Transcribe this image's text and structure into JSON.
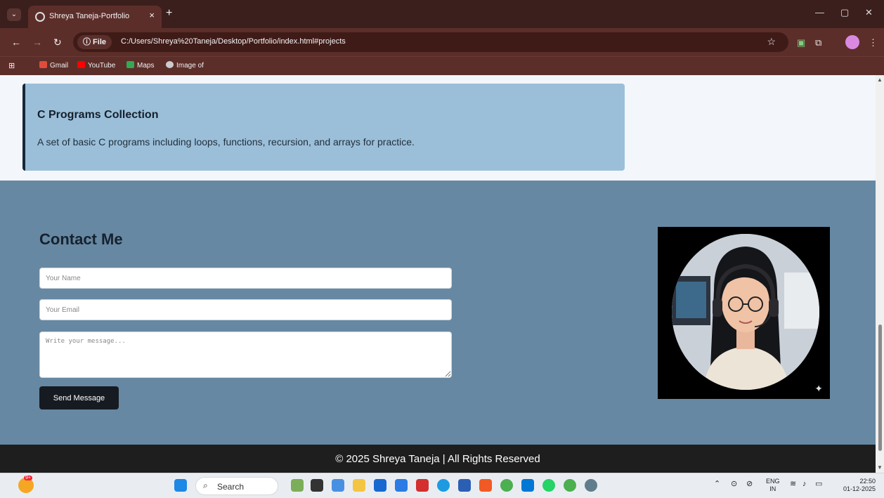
{
  "browser": {
    "tab_title": "Shreya Taneja-Portfolio",
    "tab_close": "×",
    "new_tab": "+",
    "address_chip": "ⓘ File",
    "url": "C:/Users/Shreya%20Taneja/Desktop/Portfolio/index.html#projects",
    "bookmarks": [
      "Gmail",
      "YouTube",
      "Maps",
      "Image of"
    ]
  },
  "project": {
    "title": "C Programs Collection",
    "description": "A set of basic C programs including loops, functions, recursion, and arrays for practice."
  },
  "contact": {
    "heading": "Contact Me",
    "name_placeholder": "Your Name",
    "email_placeholder": "Your Email",
    "message_placeholder": "Write your message...",
    "send_label": "Send Message"
  },
  "footer": {
    "text": "© 2025 Shreya Taneja | All Rights Reserved"
  },
  "taskbar": {
    "search_label": "Search",
    "notification_count": "9+",
    "language": "ENG",
    "region": "IN",
    "time": "22:50",
    "date": "01-12-2025"
  },
  "colors": {
    "page_bg": "#f3f6fb",
    "card_bg": "#9bbfd9",
    "contact_bg": "#6788a2",
    "footer_bg": "#1e1e1e",
    "button_bg": "#161b22"
  }
}
